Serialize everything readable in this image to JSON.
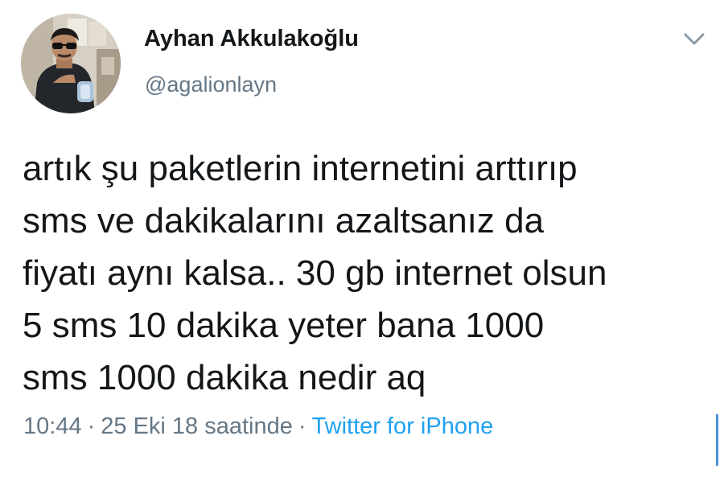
{
  "user": {
    "display_name": "Ayhan Akkulakoğlu",
    "handle": "@agalionlayn"
  },
  "tweet": {
    "lines": [
      "artık şu paketlerin internetini arttırıp",
      "sms ve dakikalarını azaltsanız da",
      "fiyatı aynı kalsa.. 30 gb internet olsun",
      "5 sms 10 dakika yeter bana 1000",
      "sms 1000 dakika nedir aq"
    ]
  },
  "meta": {
    "time": "10:44",
    "separator": "·",
    "date": "25 Eki 18 saatinde",
    "source": "Twitter for iPhone"
  },
  "icons": {
    "menu": "chevron-down-icon",
    "avatar": "profile-photo"
  },
  "colors": {
    "text": "#14171a",
    "secondary": "#657786",
    "link": "#1da1f2"
  }
}
